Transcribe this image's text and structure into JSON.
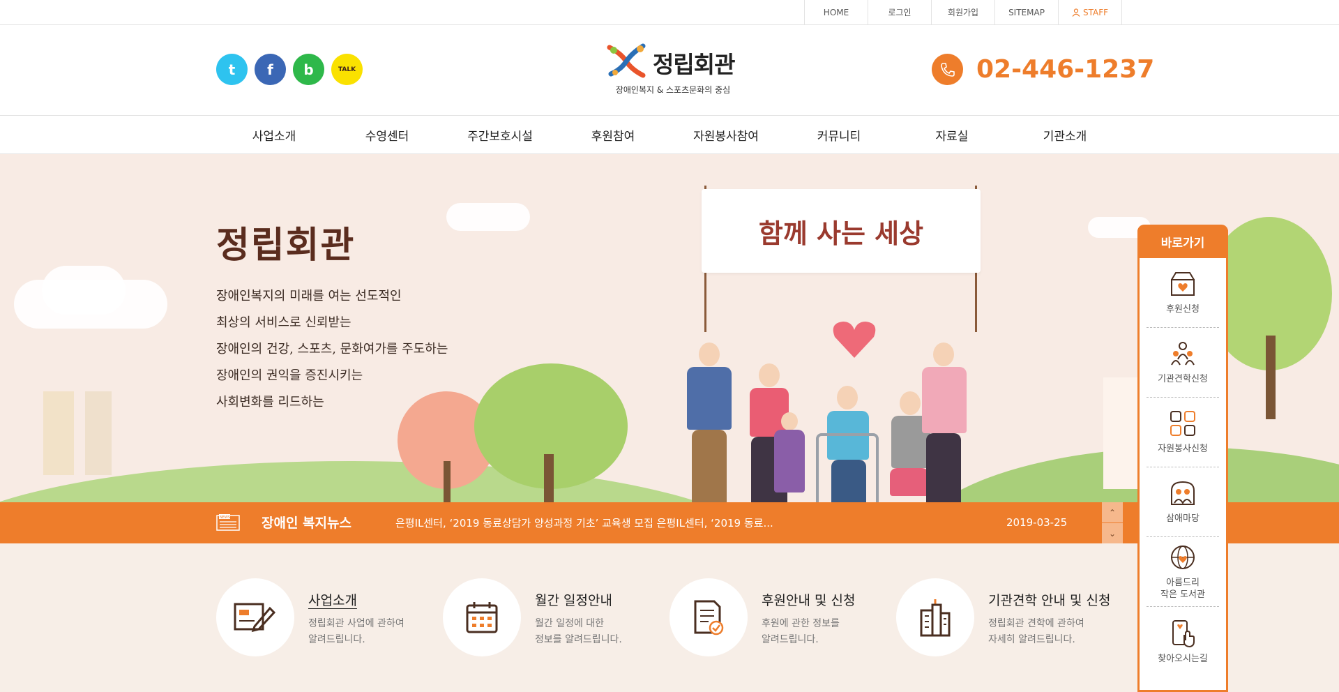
{
  "topbar": {
    "links": [
      "HOME",
      "로그인",
      "회원가입",
      "SITEMAP",
      "STAFF"
    ]
  },
  "header": {
    "sns": [
      "twitter-icon",
      "facebook-icon",
      "blog-icon",
      "kakaotalk-icon"
    ],
    "kakao_label": "TALK",
    "blog_label": "b",
    "twitter_label": "t",
    "facebook_label": "f",
    "logo_title": "정립회관",
    "logo_subtitle": "장애인복지 & 스포츠문화의 중심",
    "phone": "02-446-1237"
  },
  "gnb": {
    "items": [
      "사업소개",
      "수영센터",
      "주간보호시설",
      "후원참여",
      "자원봉사참여",
      "커뮤니티",
      "자료실",
      "기관소개"
    ]
  },
  "hero": {
    "title": "정립회관",
    "lines": [
      "장애인복지의 미래를 여는 선도적인",
      "최상의 서비스로 신뢰받는",
      "장애인의 건강, 스포츠, 문화여가를 주도하는",
      "장애인의 권익을 증진시키는",
      "사회변화를 리드하는"
    ],
    "banner": "함께 사는 세상"
  },
  "news": {
    "badge": "NEWS",
    "title": "장애인 복지뉴스",
    "text": "은평IL센터, ‘2019 동료상담가 양성과정 기초’ 교육생 모집 은평IL센터, ‘2019 동료...",
    "date": "2019-03-25",
    "up": "⌃",
    "down": "⌄"
  },
  "quick": {
    "items": [
      {
        "title": "사업소개",
        "desc": "정립회관 사업에 관하여\n알려드립니다.",
        "icon": "pencil-note-icon"
      },
      {
        "title": "월간 일정안내",
        "desc": "월간 일정에 대한\n정보를 알려드립니다.",
        "icon": "calendar-icon"
      },
      {
        "title": "후원안내 및 신청",
        "desc": "후원에 관한 정보를\n알려드립니다.",
        "icon": "document-check-icon"
      },
      {
        "title": "기관견학 안내 및 신청",
        "desc": "정립회관 견학에 관하여\n자세히 알려드립니다.",
        "icon": "building-icon"
      }
    ]
  },
  "quicklinks": {
    "title": "바로가기",
    "items": [
      {
        "label": "후원신청",
        "icon": "donation-box-icon"
      },
      {
        "label": "기관견학신청",
        "icon": "group-icon"
      },
      {
        "label": "자원봉사신청",
        "icon": "helping-hands-icon"
      },
      {
        "label": "삼애마당",
        "icon": "family-icon"
      },
      {
        "label": "아름드리\n작은 도서관",
        "icon": "globe-icon"
      },
      {
        "label": "찾아오시는길",
        "icon": "mobile-touch-icon"
      }
    ]
  },
  "colors": {
    "accent": "#ee7d2b",
    "hero_bg": "#f8ebe4",
    "quick_bg": "#f7eee7"
  }
}
